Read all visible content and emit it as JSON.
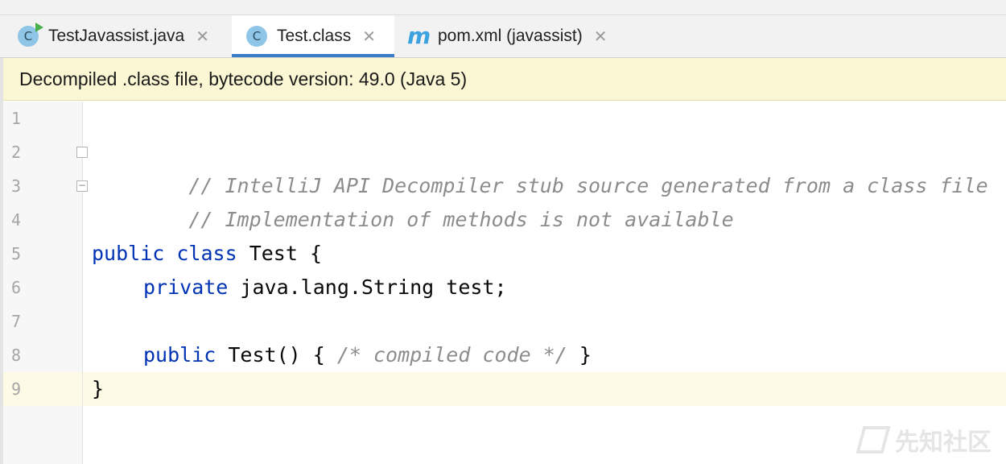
{
  "tabs": [
    {
      "label": "TestJavassist.java",
      "icon": "class-run-icon",
      "icon_glyph": "C",
      "active": false
    },
    {
      "label": "Test.class",
      "icon": "class-icon",
      "icon_glyph": "C",
      "active": true
    },
    {
      "label": "pom.xml (javassist)",
      "icon": "maven-icon",
      "icon_glyph": "m",
      "active": false
    }
  ],
  "tab_close_glyph": "✕",
  "banner": {
    "text": "Decompiled .class file, bytecode version: 49.0 (Java 5)"
  },
  "editor": {
    "line_numbers": [
      "1",
      "2",
      "3",
      "4",
      "5",
      "6",
      "7",
      "8",
      "9"
    ],
    "current_line": "9",
    "lines": {
      "l2": "// IntelliJ API Decompiler stub source generated from a class file",
      "l3": "// Implementation of methods is not available",
      "l5_kw1": "public",
      "l5_kw2": "class",
      "l5_rest": " Test {",
      "l6_kw": "private",
      "l6_rest": " java.lang.String test;",
      "l8_kw": "public",
      "l8_mid": " Test() { ",
      "l8_comment": "/* compiled code */",
      "l8_end": " }",
      "l9": "}"
    }
  },
  "watermark": "先知社区",
  "colors": {
    "keyword": "#0033b3",
    "comment": "#8c8c8c",
    "active_tab_underline": "#3d7cc9",
    "banner_bg": "#fbf6d3"
  }
}
